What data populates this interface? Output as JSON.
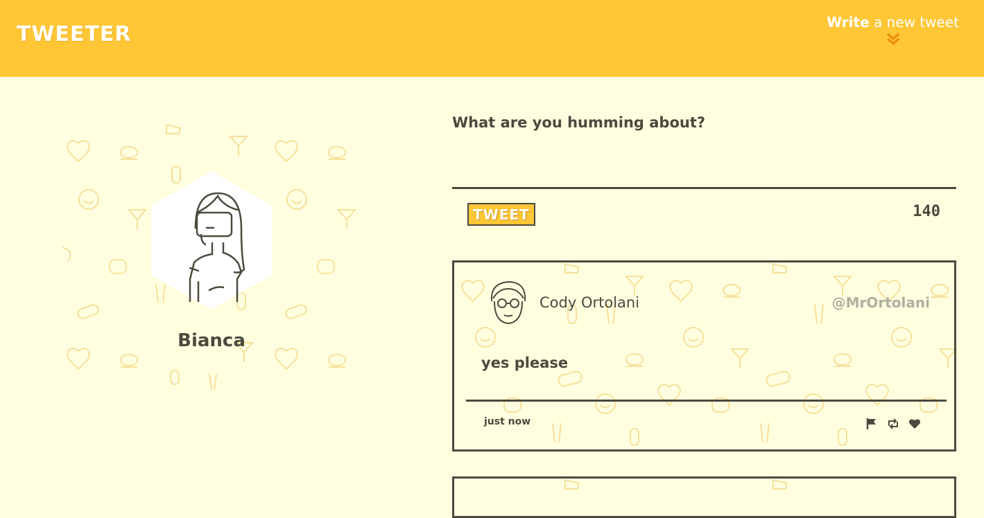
{
  "nav": {
    "logo": "TWEETER",
    "compose_bold": "Write",
    "compose_rest": " a new tweet",
    "compose_icon": "double-chevron-down-icon"
  },
  "profile": {
    "name": "Bianca"
  },
  "compose": {
    "prompt": "What are you humming about?",
    "placeholder": "",
    "button_label": "TWEET",
    "counter": "140"
  },
  "tweets": [
    {
      "name": "Cody Ortolani",
      "handle": "@MrOrtolani",
      "text": "yes please",
      "time": "just now",
      "actions": [
        "flag-icon",
        "retweet-icon",
        "heart-icon"
      ]
    }
  ],
  "colors": {
    "accent": "#ffc636",
    "background": "#ffffe0",
    "text": "#4a4a3e",
    "handle": "#b0b0a0"
  }
}
